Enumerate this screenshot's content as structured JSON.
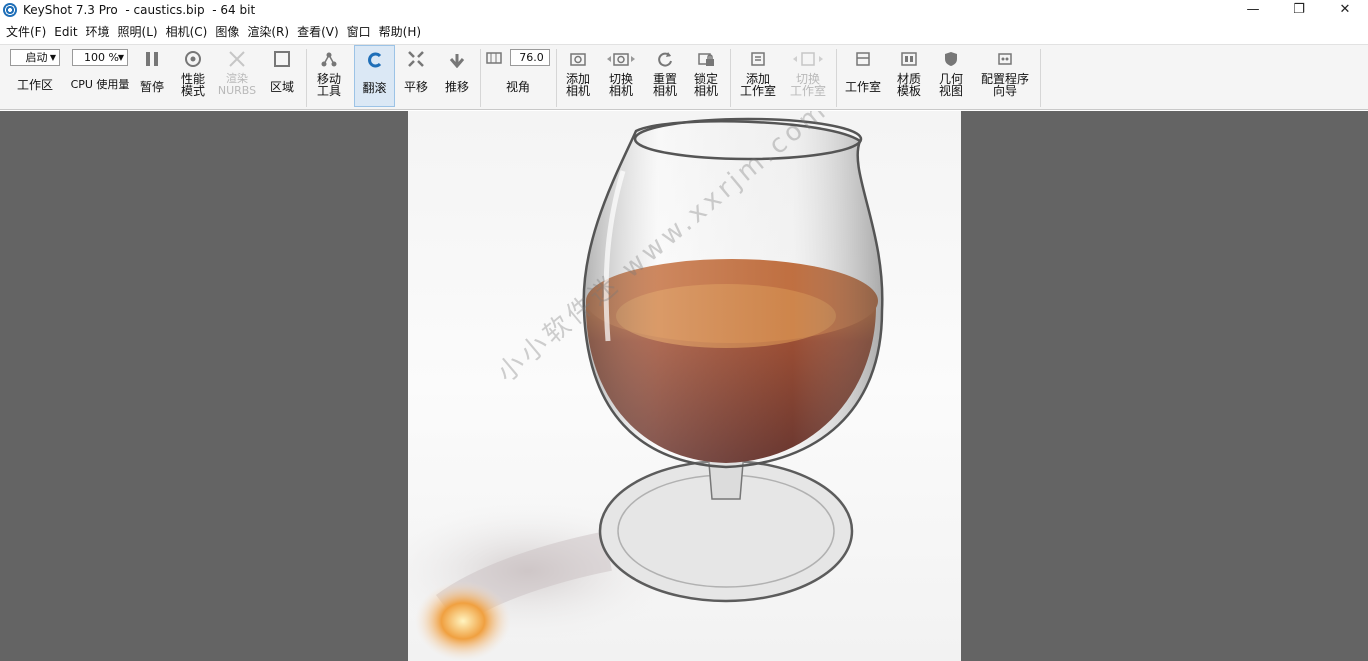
{
  "window": {
    "title": "KeyShot 7.3 Pro  - caustics.bip  - 64 bit",
    "controls": {
      "minimize": "—",
      "restore": "❐",
      "close": "✕"
    }
  },
  "menu": [
    "文件(F)",
    "Edit",
    "环境",
    "照明(L)",
    "相机(C)",
    "图像",
    "渲染(R)",
    "查看(V)",
    "窗口",
    "帮助(H)"
  ],
  "toolbar": {
    "workspace": {
      "value": "启动",
      "label": "工作区"
    },
    "cpu": {
      "value": "100 %",
      "label": "CPU 使用量"
    },
    "pause_label": "暂停",
    "performance_label": "性能\n模式",
    "render_nurbs_label": "渲染\nNURBS",
    "region_label": "区域",
    "move_tool_label": "移动\n工具",
    "tumble_label": "翻滚",
    "pan_label": "平移",
    "dolly_label": "推移",
    "fov": {
      "value": "76.0",
      "label": "视角"
    },
    "add_camera_label": "添加\n相机",
    "switch_camera_label": "切换\n相机",
    "reset_camera_label": "重置\n相机",
    "lock_camera_label": "锁定\n相机",
    "add_studio_label": "添加\n工作室",
    "switch_studio_label": "切换\n工作室",
    "studio_label": "工作室",
    "material_template_label": "材质\n模板",
    "geometry_view_label": "几何\n视图",
    "config_wizard_label": "配置程序\n向导"
  },
  "viewport": {
    "watermark": "小小软件迷 www.xxrjm.com"
  },
  "colors": {
    "viewport_bg": "#646464",
    "toolbar_bg": "#f5f5f5",
    "active_tool": "#dbe8f5",
    "accent": "#1f6fb8",
    "liquid": "#6e1808"
  }
}
